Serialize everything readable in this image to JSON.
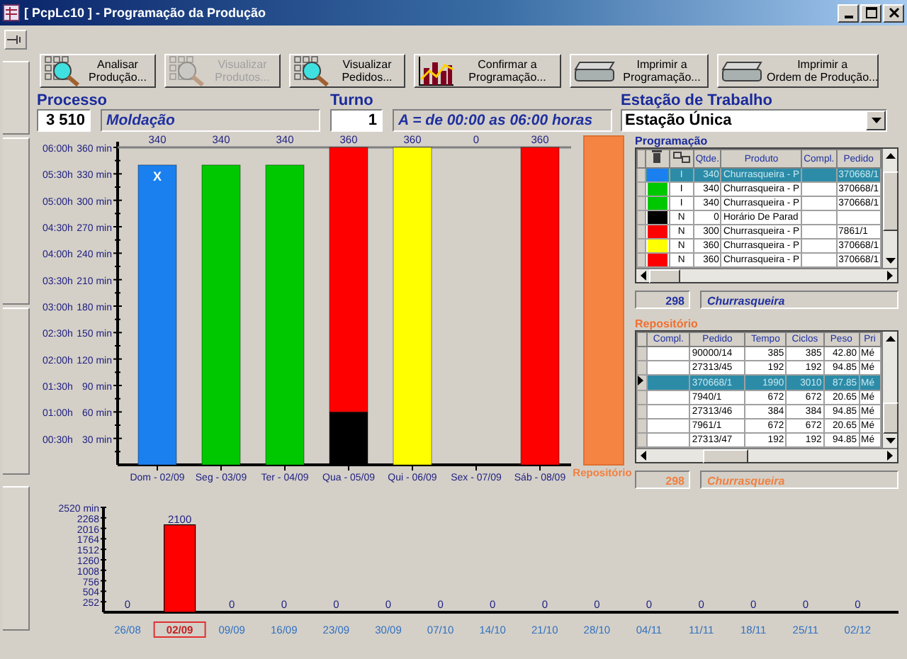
{
  "window": {
    "title": "[ PcpLc10 ] - Programação da Produção"
  },
  "toolbar": [
    {
      "label": "Analisar\nProdução...",
      "kind": "analyze",
      "disabled": false
    },
    {
      "label": "Visualizar\nProdutos...",
      "kind": "analyze",
      "disabled": true
    },
    {
      "label": "Visualizar\nPedidos...",
      "kind": "analyze",
      "disabled": false
    },
    {
      "label": "Confirmar a\nProgramação...",
      "kind": "report",
      "disabled": false
    },
    {
      "label": "Imprimir a\nProgramação...",
      "kind": "print",
      "disabled": false
    },
    {
      "label": "Imprimir a\nOrdem de Produção...",
      "kind": "print",
      "disabled": false
    }
  ],
  "processo": {
    "label": "Processo",
    "value": "3 510",
    "description": "Moldação"
  },
  "turno": {
    "label": "Turno",
    "value": "1",
    "description": "A = de 00:00 as 06:00 horas"
  },
  "estacao": {
    "label": "Estação de Trabalho",
    "value": "Estação Única"
  },
  "daily_chart": {
    "repository_label": "Repositório",
    "hour_labels": [
      "06:00h",
      "05:30h",
      "05:00h",
      "04:30h",
      "04:00h",
      "03:30h",
      "03:00h",
      "02:30h",
      "02:00h",
      "01:30h",
      "01:00h",
      "00:30h"
    ],
    "bar_marks": [
      {
        "text": "X"
      }
    ],
    "chart_data": {
      "type": "bar",
      "stacked": true,
      "categories": [
        "Dom - 02/09",
        "Seg - 03/09",
        "Ter - 04/09",
        "Qua - 05/09",
        "Qui - 06/09",
        "Sex - 07/09",
        "Sáb - 08/09"
      ],
      "series": [
        {
          "color": "#1a80f0",
          "values": [
            340,
            null,
            null,
            null,
            null,
            null,
            null
          ]
        },
        {
          "color": "#00c800",
          "values": [
            null,
            340,
            340,
            null,
            null,
            null,
            null
          ]
        },
        {
          "color": "#000000",
          "values": [
            null,
            null,
            null,
            60,
            null,
            null,
            null
          ]
        },
        {
          "color": "#ff0000",
          "values": [
            null,
            null,
            null,
            300,
            null,
            null,
            360
          ]
        },
        {
          "color": "#ffff00",
          "values": [
            null,
            null,
            null,
            null,
            360,
            null,
            null
          ]
        }
      ],
      "ylim": [
        0,
        360
      ],
      "yticks": [
        {
          "value": 30,
          "label": "30 min"
        },
        {
          "value": 60,
          "label": "60 min"
        },
        {
          "value": 90,
          "label": "90 min"
        },
        {
          "value": 120,
          "label": "120 min"
        },
        {
          "value": 150,
          "label": "150 min"
        },
        {
          "value": 180,
          "label": "180 min"
        },
        {
          "value": 210,
          "label": "210 min"
        },
        {
          "value": 240,
          "label": "240 min"
        },
        {
          "value": 270,
          "label": "270 min"
        },
        {
          "value": 300,
          "label": "300 min"
        },
        {
          "value": 330,
          "label": "330 min"
        },
        {
          "value": 360,
          "label": "360 min"
        }
      ],
      "value_labels": [
        "340",
        "340",
        "340",
        "360",
        "360",
        "0",
        "360"
      ]
    }
  },
  "programacao": {
    "title": "Programação",
    "columns": [
      "Qtde.",
      "Produto",
      "Compl.",
      "Pedido"
    ],
    "rows": [
      {
        "color": "#1a80f0",
        "type": "I",
        "qty": "340",
        "product": "Churrasqueira - P",
        "order": "370668/1",
        "selected": true
      },
      {
        "color": "#00c800",
        "type": "I",
        "qty": "340",
        "product": "Churrasqueira - P",
        "order": "370668/1",
        "selected": false
      },
      {
        "color": "#00c800",
        "type": "I",
        "qty": "340",
        "product": "Churrasqueira - P",
        "order": "370668/1",
        "selected": false
      },
      {
        "color": "#000000",
        "type": "N",
        "qty": "0",
        "product": "Horário De Parad",
        "selected": false
      },
      {
        "color": "#ff0000",
        "type": "N",
        "qty": "300",
        "product": "Churrasqueira - P",
        "order": "7861/1",
        "selected": false
      },
      {
        "color": "#ffff00",
        "type": "N",
        "qty": "360",
        "product": "Churrasqueira - P",
        "order": "370668/1",
        "selected": false
      },
      {
        "color": "#ff0000",
        "type": "N",
        "qty": "360",
        "product": "Churrasqueira - P",
        "order": "370668/1",
        "selected": false
      }
    ],
    "footer_code": "298",
    "footer_name": "Churrasqueira"
  },
  "repositorio": {
    "title": "Repositório",
    "columns": [
      "Compl.",
      "Pedido",
      "Tempo",
      "Ciclos",
      "Peso",
      "Pri"
    ],
    "rows": [
      {
        "order": "90000/14",
        "time": "385",
        "cycles": "385",
        "weight": "42.80",
        "priority": "Mé",
        "selected": false
      },
      {
        "order": "27313/45",
        "time": "192",
        "cycles": "192",
        "weight": "94.85",
        "priority": "Mé",
        "selected": false
      },
      {
        "order": "370668/1",
        "time": "1990",
        "cycles": "3010",
        "weight": "87.85",
        "priority": "Mé",
        "selected": true
      },
      {
        "order": "7940/1",
        "time": "672",
        "cycles": "672",
        "weight": "20.65",
        "priority": "Mé",
        "selected": false
      },
      {
        "order": "27313/46",
        "time": "384",
        "cycles": "384",
        "weight": "94.85",
        "priority": "Mé",
        "selected": false
      },
      {
        "order": "7961/1",
        "time": "672",
        "cycles": "672",
        "weight": "20.65",
        "priority": "Mé",
        "selected": false
      },
      {
        "order": "27313/47",
        "time": "192",
        "cycles": "192",
        "weight": "94.85",
        "priority": "Mé",
        "selected": false
      }
    ],
    "footer_code": "298",
    "footer_name": "Churrasqueira"
  },
  "weekly_chart": {
    "weeks": [
      {
        "selected": false
      },
      {
        "selected": true
      },
      {
        "selected": false
      },
      {
        "selected": false
      },
      {
        "selected": false
      },
      {
        "selected": false
      },
      {
        "selected": false
      },
      {
        "selected": false
      },
      {
        "selected": false
      },
      {
        "selected": false
      },
      {
        "selected": false
      },
      {
        "selected": false
      },
      {
        "selected": false
      },
      {
        "selected": false
      },
      {
        "selected": false
      }
    ],
    "chart_data": {
      "type": "bar",
      "categories": [
        "26/08",
        "02/09",
        "09/09",
        "16/09",
        "23/09",
        "30/09",
        "07/10",
        "14/10",
        "21/10",
        "28/10",
        "04/11",
        "11/11",
        "18/11",
        "25/11",
        "02/12"
      ],
      "series": [
        {
          "color": "#ff0000",
          "values": [
            0,
            2100,
            0,
            0,
            0,
            0,
            0,
            0,
            0,
            0,
            0,
            0,
            0,
            0,
            0
          ]
        }
      ],
      "ylim": [
        0,
        2520
      ],
      "yticks": [
        252,
        504,
        756,
        1008,
        1260,
        1512,
        1764,
        2016,
        2268,
        {
          "value": 2520,
          "label": "2520 min"
        }
      ],
      "data_labels": true
    }
  }
}
